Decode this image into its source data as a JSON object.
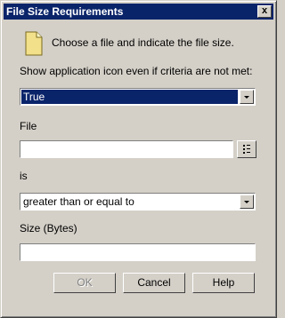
{
  "dialog": {
    "title": "File Size Requirements",
    "close_label": "x",
    "header_text": "Choose a file and indicate the file size."
  },
  "fields": {
    "show_icon_label": "Show application icon even if criteria are not met:",
    "show_icon_value": "True",
    "file_label": "File",
    "file_value": "",
    "is_label": "is",
    "is_value": "greater than or equal to",
    "size_label": "Size (Bytes)",
    "size_value": ""
  },
  "buttons": {
    "ok": "OK",
    "cancel": "Cancel",
    "help": "Help"
  },
  "icons": {
    "header": "file-icon",
    "browse": "browse-icon",
    "dropdown": "chevron-down-icon",
    "close": "close-icon"
  },
  "colors": {
    "titlebar": "#0a246a",
    "face": "#d4d0c8",
    "selection": "#0a246a"
  }
}
